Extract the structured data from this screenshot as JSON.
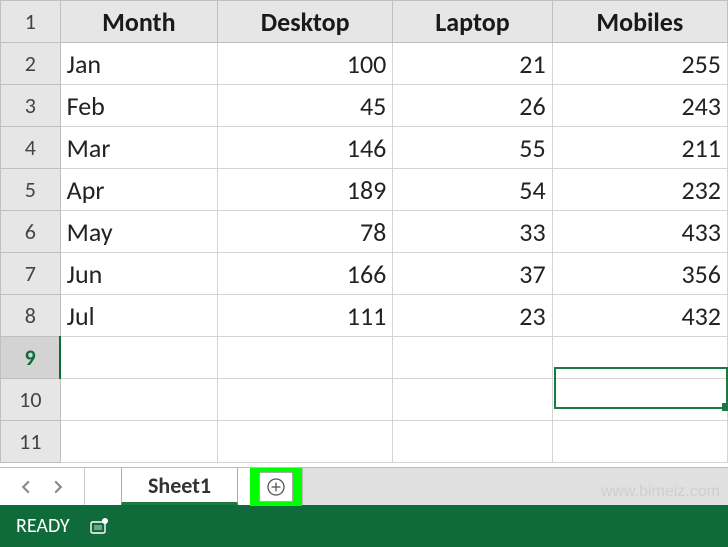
{
  "grid": {
    "headers": [
      "Month",
      "Desktop",
      "Laptop",
      "Mobiles"
    ],
    "row_numbers": [
      1,
      2,
      3,
      4,
      5,
      6,
      7,
      8,
      9,
      10,
      11
    ],
    "rows": [
      {
        "month": "Jan",
        "desktop": 100,
        "laptop": 21,
        "mobiles": 255
      },
      {
        "month": "Feb",
        "desktop": 45,
        "laptop": 26,
        "mobiles": 243
      },
      {
        "month": "Mar",
        "desktop": 146,
        "laptop": 55,
        "mobiles": 211
      },
      {
        "month": "Apr",
        "desktop": 189,
        "laptop": 54,
        "mobiles": 232
      },
      {
        "month": "May",
        "desktop": 78,
        "laptop": 33,
        "mobiles": 433
      },
      {
        "month": "Jun",
        "desktop": 166,
        "laptop": 37,
        "mobiles": 356
      },
      {
        "month": "Jul",
        "desktop": 111,
        "laptop": 23,
        "mobiles": 432
      }
    ],
    "selected_row": 9,
    "active_cell": "E9"
  },
  "tabs": {
    "active_sheet": "Sheet1"
  },
  "status": {
    "text": "READY"
  },
  "watermark": "www.bimeiz.com",
  "chart_data": {
    "type": "table",
    "title": "",
    "headers": [
      "Month",
      "Desktop",
      "Laptop",
      "Mobiles"
    ],
    "categories": [
      "Jan",
      "Feb",
      "Mar",
      "Apr",
      "May",
      "Jun",
      "Jul"
    ],
    "series": [
      {
        "name": "Desktop",
        "values": [
          100,
          45,
          146,
          189,
          78,
          166,
          111
        ]
      },
      {
        "name": "Laptop",
        "values": [
          21,
          26,
          55,
          54,
          33,
          37,
          23
        ]
      },
      {
        "name": "Mobiles",
        "values": [
          255,
          243,
          211,
          232,
          433,
          356,
          432
        ]
      }
    ]
  }
}
